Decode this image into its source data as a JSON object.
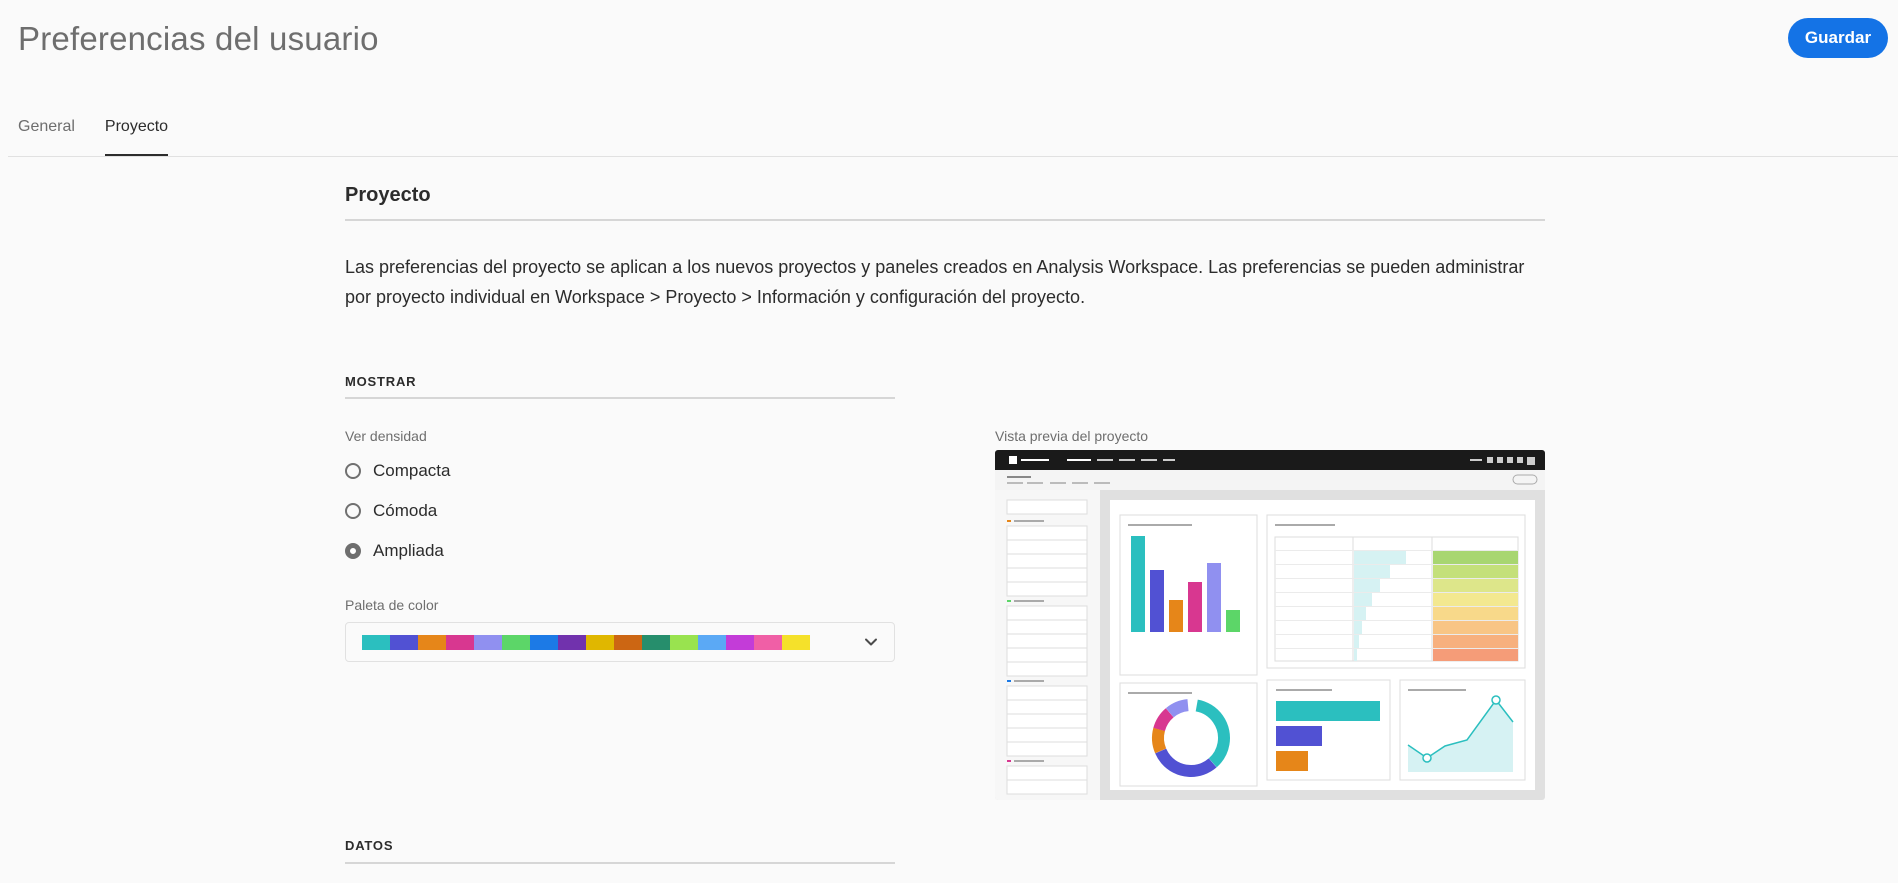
{
  "header": {
    "title": "Preferencias del usuario",
    "save_label": "Guardar"
  },
  "tabs": [
    {
      "label": "General",
      "active": false
    },
    {
      "label": "Proyecto",
      "active": true
    }
  ],
  "section": {
    "title": "Proyecto",
    "description": "Las preferencias del proyecto se aplican a los nuevos proyectos y paneles creados en Analysis Workspace. Las preferencias se pueden administrar por proyecto individual en Workspace > Proyecto > Información y configuración del proyecto."
  },
  "display": {
    "heading": "MOSTRAR",
    "density_label": "Ver densidad",
    "density_options": [
      {
        "label": "Compacta",
        "checked": false
      },
      {
        "label": "Cómoda",
        "checked": false
      },
      {
        "label": "Ampliada",
        "checked": true
      }
    ],
    "palette_label": "Paleta de color",
    "palette_colors": [
      "#2bbfbf",
      "#5151d3",
      "#e68619",
      "#d83790",
      "#9090f0",
      "#5cd668",
      "#1c7ae6",
      "#7132ad",
      "#e0b700",
      "#cc6613",
      "#268e6c",
      "#99e34f",
      "#5ba9f5",
      "#c33cd8",
      "#f05fa6",
      "#f5e12a"
    ],
    "preview_label": "Vista previa del proyecto"
  },
  "data_section": {
    "heading": "DATOS"
  }
}
